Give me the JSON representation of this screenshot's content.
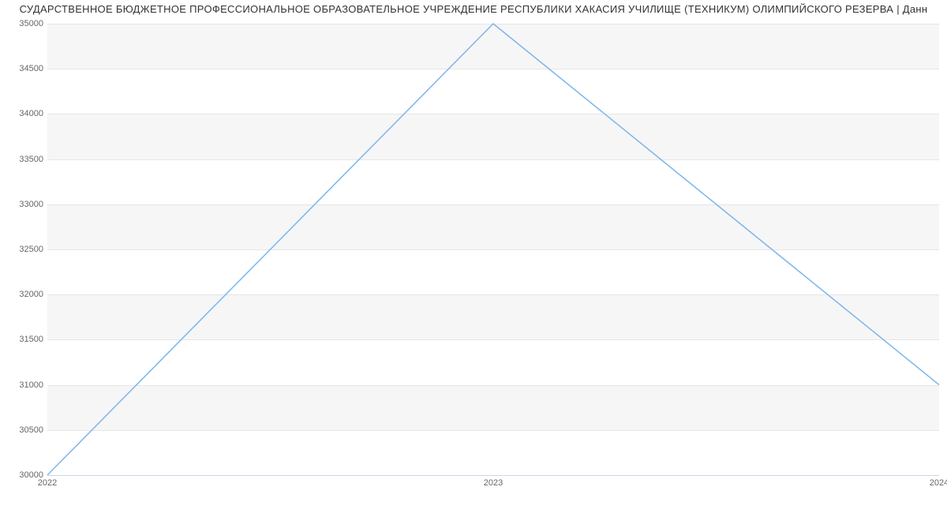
{
  "chart_data": {
    "type": "line",
    "title": "СУДАРСТВЕННОЕ БЮДЖЕТНОЕ ПРОФЕССИОНАЛЬНОЕ ОБРАЗОВАТЕЛЬНОЕ УЧРЕЖДЕНИЕ РЕСПУБЛИКИ ХАКАСИЯ УЧИЛИЩЕ (ТЕХНИКУМ) ОЛИМПИЙСКОГО РЕЗЕРВА | Данн",
    "x": [
      "2022",
      "2023",
      "2024"
    ],
    "values": [
      30000,
      35000,
      31000
    ],
    "ylim": [
      30000,
      35000
    ],
    "yticks": [
      30000,
      30500,
      31000,
      31500,
      32000,
      32500,
      33000,
      33500,
      34000,
      34500,
      35000
    ],
    "xlabel": "",
    "ylabel": ""
  }
}
